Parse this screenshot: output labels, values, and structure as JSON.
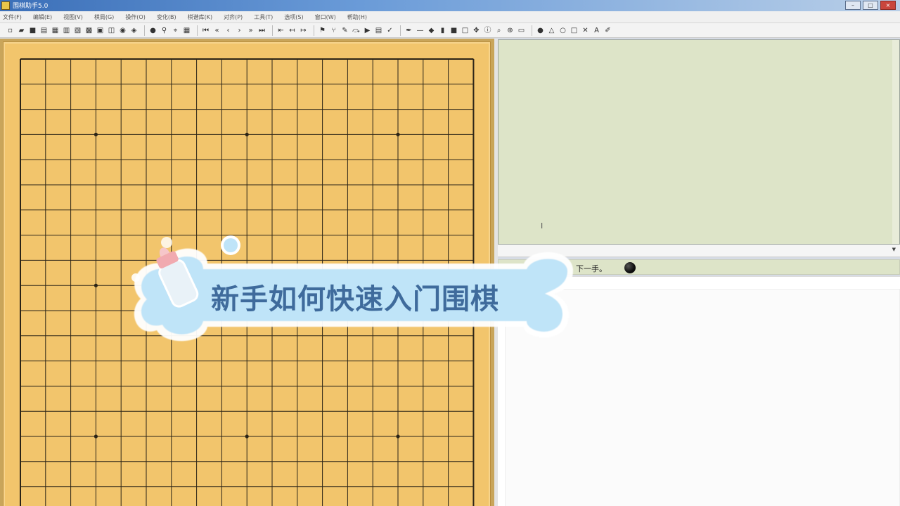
{
  "window": {
    "title": "围棋助手5.0",
    "buttons": {
      "minimize": "–",
      "maximize": "□",
      "close": "×"
    }
  },
  "menu": {
    "items": [
      "文件(F)",
      "编辑(E)",
      "视图(V)",
      "棋局(G)",
      "操作(O)",
      "变化(B)",
      "棋谱库(K)",
      "对弈(P)",
      "工具(T)",
      "选项(S)",
      "窗口(W)",
      "帮助(H)"
    ]
  },
  "toolbar": {
    "groups": [
      [
        "new-icon",
        "open-icon",
        "save-icon",
        "save-as-icon",
        "print-icon",
        "copy-icon",
        "paste-icon",
        "board-icon",
        "image-icon",
        "export-icon",
        "web-icon",
        "options-icon"
      ],
      [
        "stone-icon",
        "pin-icon",
        "marker-icon",
        "grid-icon"
      ],
      [
        "first-move-icon",
        "prev-10-icon",
        "prev-move-icon",
        "next-move-icon",
        "next-10-icon",
        "last-move-icon"
      ],
      [
        "var-first-icon",
        "var-prev-icon",
        "var-next-icon"
      ],
      [
        "analyze-icon",
        "tree-icon",
        "edit-icon",
        "pass-icon",
        "play-icon",
        "score-icon",
        "hint-icon"
      ],
      [
        "pen-icon",
        "line-icon",
        "diamond-icon",
        "bookmark-icon",
        "stop-icon",
        "rect-icon",
        "cross-move-icon",
        "info-icon",
        "find-icon",
        "zoom-icon",
        "view-icon"
      ],
      [
        "black-stone-icon",
        "triangle-icon",
        "circle-icon",
        "square-icon",
        "cross-icon",
        "letter-icon",
        "brush-icon"
      ]
    ],
    "glyphs": {
      "new-icon": "▫",
      "open-icon": "▰",
      "save-icon": "■",
      "save-as-icon": "▤",
      "print-icon": "▦",
      "copy-icon": "▥",
      "paste-icon": "▧",
      "board-icon": "▩",
      "image-icon": "▣",
      "export-icon": "◫",
      "web-icon": "◉",
      "options-icon": "◈",
      "stone-icon": "●",
      "pin-icon": "⚲",
      "marker-icon": "⌖",
      "grid-icon": "▦",
      "first-move-icon": "⏮",
      "prev-10-icon": "«",
      "prev-move-icon": "‹",
      "next-move-icon": "›",
      "next-10-icon": "»",
      "last-move-icon": "⏭",
      "var-first-icon": "⇤",
      "var-prev-icon": "↤",
      "var-next-icon": "↦",
      "analyze-icon": "⚑",
      "tree-icon": "⑂",
      "edit-icon": "✎",
      "pass-icon": "⤼",
      "play-icon": "▶",
      "score-icon": "▤",
      "hint-icon": "✓",
      "pen-icon": "✒",
      "line-icon": "—",
      "diamond-icon": "◆",
      "bookmark-icon": "▮",
      "stop-icon": "■",
      "rect-icon": "□",
      "cross-move-icon": "✥",
      "info-icon": "ⓘ",
      "find-icon": "⌕",
      "zoom-icon": "⊕",
      "view-icon": "▭",
      "black-stone-icon": "●",
      "triangle-icon": "△",
      "circle-icon": "○",
      "square-icon": "□",
      "cross-icon": "✕",
      "letter-icon": "A",
      "brush-icon": "✐"
    }
  },
  "board": {
    "size": 19,
    "star_points": [
      [
        3,
        3
      ],
      [
        3,
        9
      ],
      [
        3,
        15
      ],
      [
        9,
        3
      ],
      [
        9,
        9
      ],
      [
        9,
        15
      ],
      [
        15,
        3
      ],
      [
        15,
        9
      ],
      [
        15,
        15
      ]
    ],
    "colors": {
      "wood": "#f2c56c",
      "line": "#2b2417",
      "border": "#b98d3c"
    }
  },
  "status": {
    "text": "下一手。",
    "next_player": "black"
  },
  "overlay": {
    "caption": "新手如何快速入门围棋",
    "colors": {
      "bubble": "#bfe4f8",
      "bubble_edge": "#ffffff",
      "text": "#3f6b9c"
    }
  }
}
